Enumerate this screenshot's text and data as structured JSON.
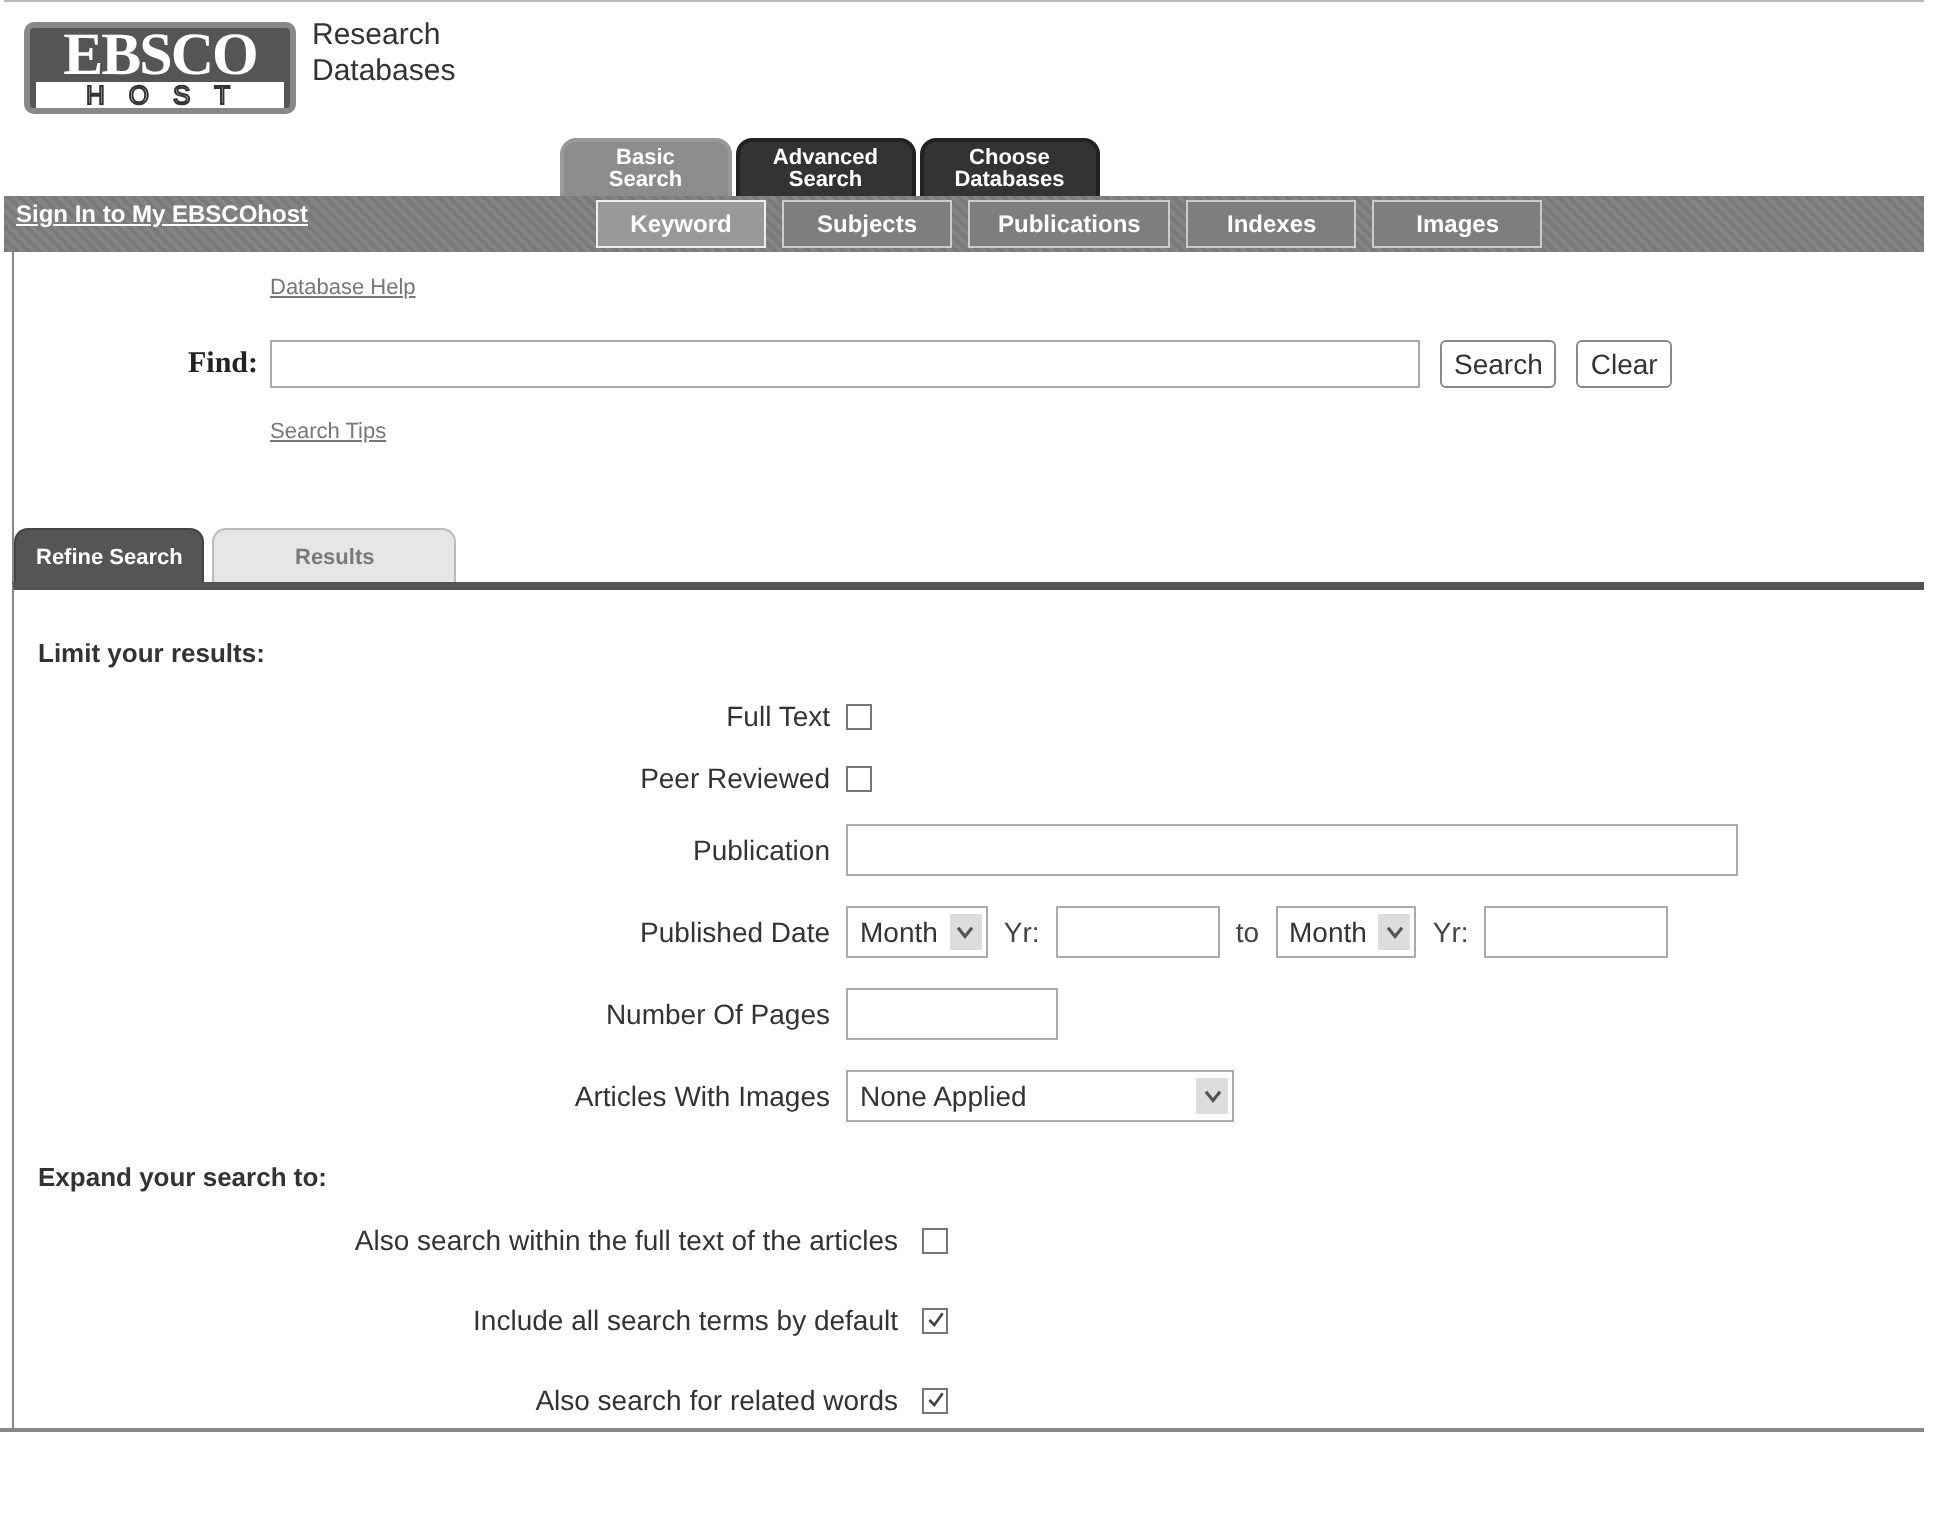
{
  "logo": {
    "wordmark": "EBSCO",
    "sub": "HOST",
    "caption_lines": [
      "Research",
      "Databases"
    ]
  },
  "search_tabs": [
    {
      "label": "Basic Search",
      "selected": true
    },
    {
      "label": "Advanced Search",
      "selected": false
    },
    {
      "label": "Choose Databases",
      "selected": false
    }
  ],
  "sign_in": "Sign In to My EBSCOhost",
  "sub_tabs": [
    {
      "label": "Keyword",
      "selected": true
    },
    {
      "label": "Subjects",
      "selected": false
    },
    {
      "label": "Publications",
      "selected": false
    },
    {
      "label": "Indexes",
      "selected": false
    },
    {
      "label": "Images",
      "selected": false
    }
  ],
  "database_help": "Database Help",
  "find": {
    "label": "Find:"
  },
  "buttons": [
    "Search",
    "Clear"
  ],
  "search_tips": "Search Tips",
  "panel_tabs": [
    {
      "label": "Refine Search",
      "selected": true,
      "disabled": false
    },
    {
      "label": "Results",
      "selected": false,
      "disabled": true
    }
  ],
  "limit": {
    "heading": "Limit your results:",
    "rows": [
      {
        "kind": "checkbox",
        "label": "Full Text",
        "checked": false
      },
      {
        "kind": "checkbox",
        "label": "Peer Reviewed",
        "checked": false
      },
      {
        "kind": "text",
        "label": "Publication"
      },
      {
        "kind": "date_range",
        "label": "Published Date",
        "from_month": "Month",
        "from_yr_label": "Yr:",
        "to_label": "to",
        "to_month": "Month",
        "to_yr_label": "Yr:"
      },
      {
        "kind": "short_text",
        "label": "Number Of Pages"
      },
      {
        "kind": "select",
        "label": "Articles With Images",
        "value": "None Applied"
      }
    ]
  },
  "expand": {
    "heading": "Expand your search to:",
    "options": [
      {
        "label": "Also search within the full text of the articles",
        "checked": false
      },
      {
        "label": "Include all search terms by default",
        "checked": true
      },
      {
        "label": "Also search for related words",
        "checked": true
      }
    ]
  }
}
